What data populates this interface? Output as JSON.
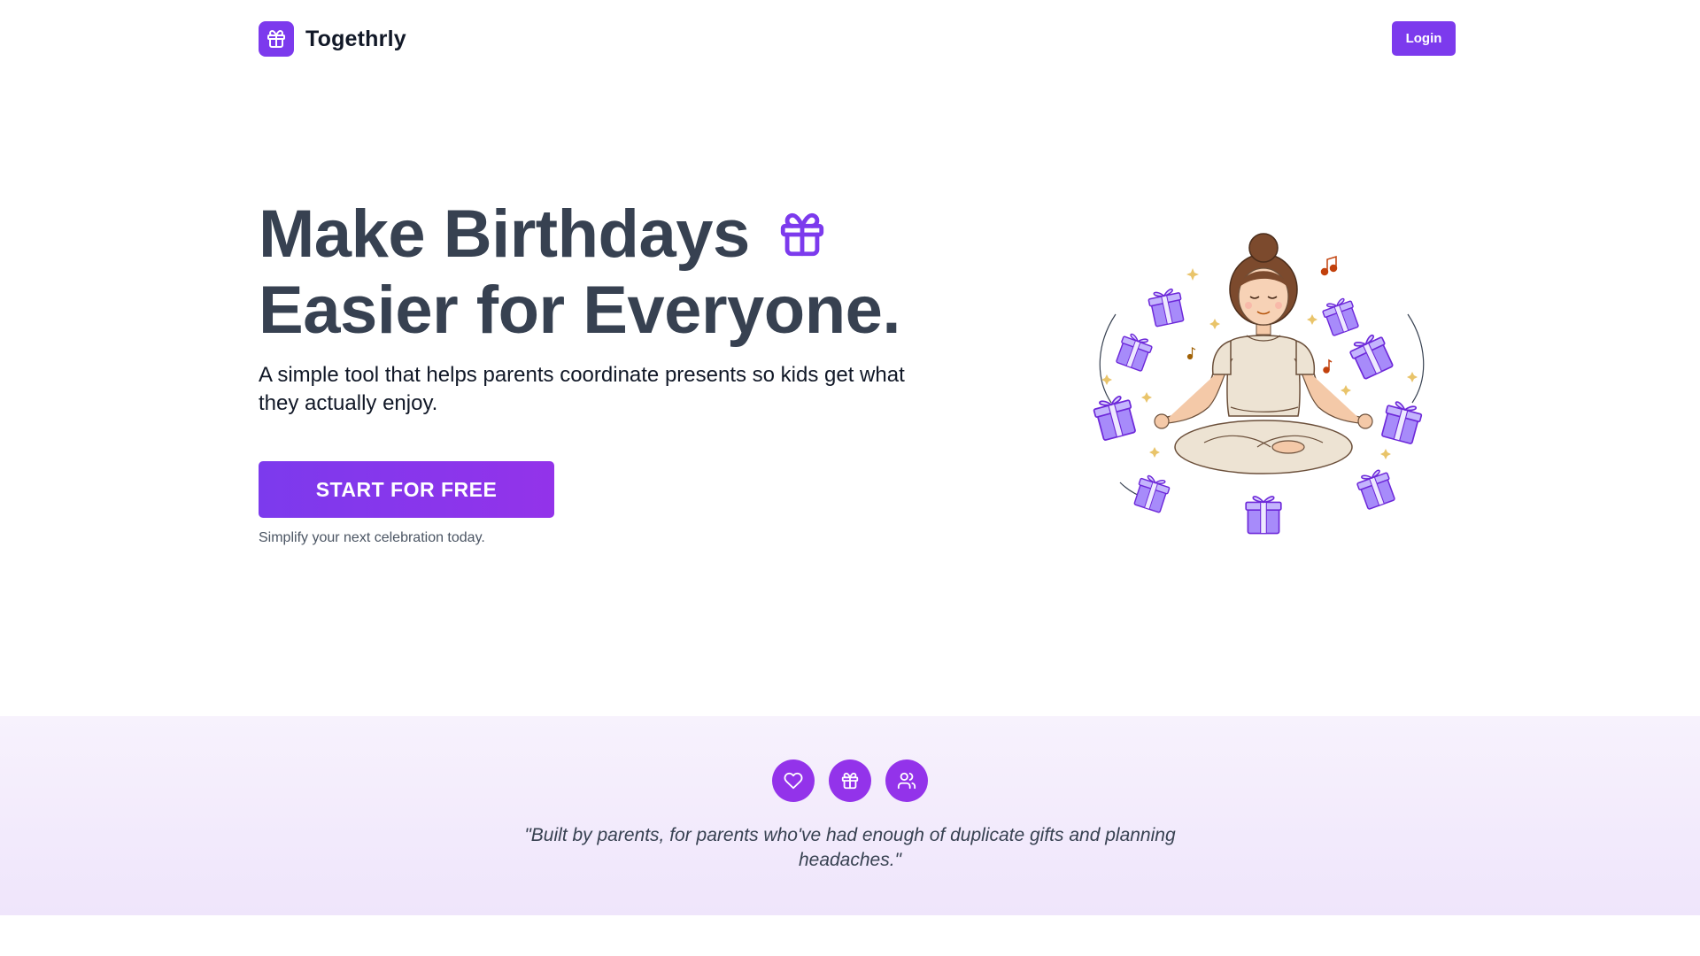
{
  "header": {
    "brand_name": "Togethrly",
    "login_label": "Login"
  },
  "hero": {
    "title_line1": "Make Birthdays",
    "title_line2": "Easier for Everyone.",
    "subtitle": "A simple tool that helps parents coordinate presents so kids get what they actually enjoy.",
    "cta_label": "START FOR FREE",
    "cta_note": "Simplify your next celebration today."
  },
  "band": {
    "icons": [
      "heart-icon",
      "gift-icon",
      "users-icon"
    ],
    "quote": "\"Built by parents, for parents who've had enough of duplicate gifts and planning headaches.\""
  },
  "colors": {
    "accent": "#7c3aed",
    "accent_alt": "#9333ea",
    "heading": "#374151",
    "band_bg": "#f3ecfc"
  }
}
